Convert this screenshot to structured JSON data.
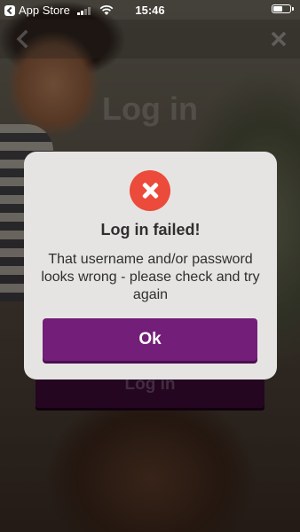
{
  "status_bar": {
    "back_app_label": "App Store",
    "time": "15:46",
    "battery_level": 0.55,
    "signal_bars_on": 2
  },
  "nav": {
    "back_icon": "chevron-left-icon",
    "close_icon": "close-icon"
  },
  "login": {
    "title": "Log in",
    "button_label": "Log in"
  },
  "alert": {
    "icon": "error-x-icon",
    "icon_color": "#ec4a3a",
    "title": "Log in failed!",
    "message": "That username and/or password looks wrong - please check and try again",
    "ok_label": "Ok",
    "ok_color": "#731e78"
  }
}
